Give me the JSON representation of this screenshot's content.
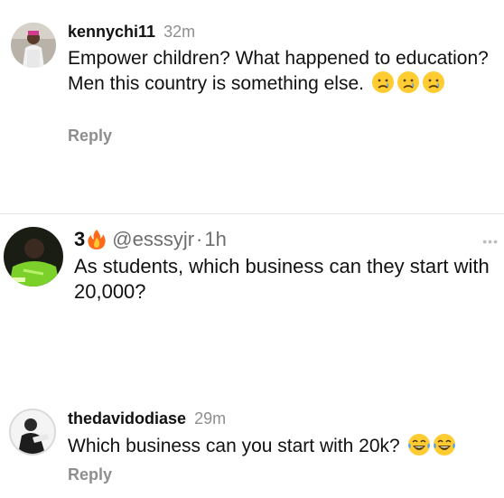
{
  "comments": [
    {
      "username": "kennychi11",
      "time": "32m",
      "text": "Empower children? What happened to education?  Men this country is something else.",
      "emojis": [
        "crying-face",
        "crying-face",
        "crying-face"
      ],
      "reply_label": "Reply"
    },
    {
      "display_name": "3",
      "name_emoji": "fire",
      "handle": "@esssyjr",
      "separator": "·",
      "time": "1h",
      "text": "As students, which business can they start with 20,000?",
      "more_label": "•••"
    },
    {
      "username": "thedavidodiase",
      "time": "29m",
      "text": "Which business can you start with 20k?",
      "emojis": [
        "tears-of-joy",
        "tears-of-joy"
      ],
      "reply_label": "Reply"
    }
  ]
}
